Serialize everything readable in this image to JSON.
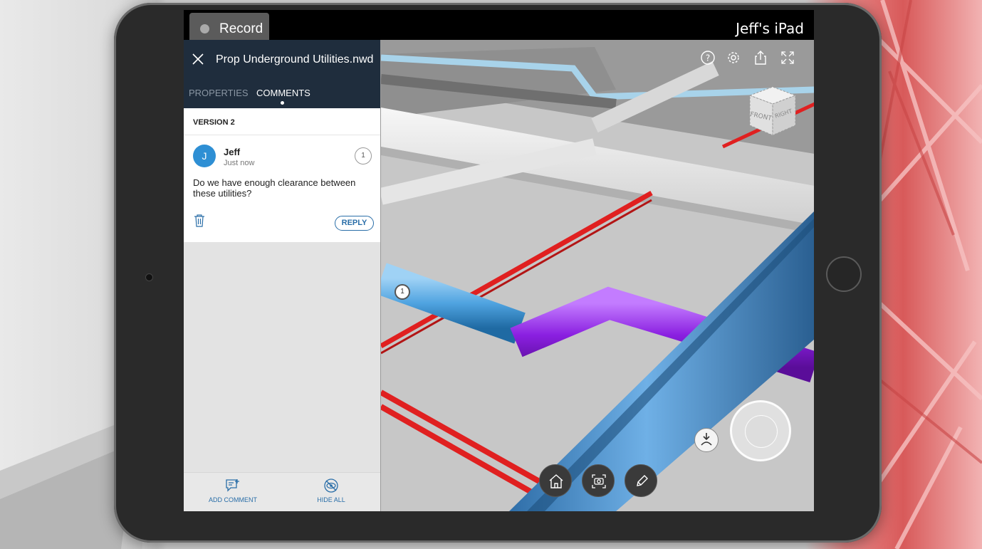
{
  "status_bar": {
    "record_label": "Record",
    "device_name": "Jeff's iPad"
  },
  "panel": {
    "file_title": "Prop Underground Utilities.nwd",
    "tabs": [
      {
        "label": "PROPERTIES",
        "active": false
      },
      {
        "label": "COMMENTS",
        "active": true
      }
    ],
    "version_label": "VERSION 2",
    "comment": {
      "avatar_initial": "J",
      "author": "Jeff",
      "time": "Just now",
      "number": "1",
      "body": "Do we have enough clearance between these utilities?",
      "reply_label": "REPLY"
    },
    "footer": {
      "add_comment_label": "ADD COMMENT",
      "hide_all_label": "HIDE ALL"
    }
  },
  "viewport": {
    "viewcube_front_label": "FRONT",
    "viewcube_right_label": "RIGHT",
    "markup_pin_number": "1",
    "toolbar_icons": [
      "help-icon",
      "settings-icon",
      "share-icon",
      "fullscreen-icon"
    ],
    "nav_icons": [
      "home-icon",
      "camera-icon",
      "pencil-icon"
    ]
  },
  "colors": {
    "panel_header": "#1f2d3d",
    "accent_blue": "#2a6ea8",
    "avatar": "#2e8fd4",
    "pipe_red": "#e02020",
    "pipe_purple": "#8a1fe0",
    "pipe_blue": "#4fa3e0"
  }
}
